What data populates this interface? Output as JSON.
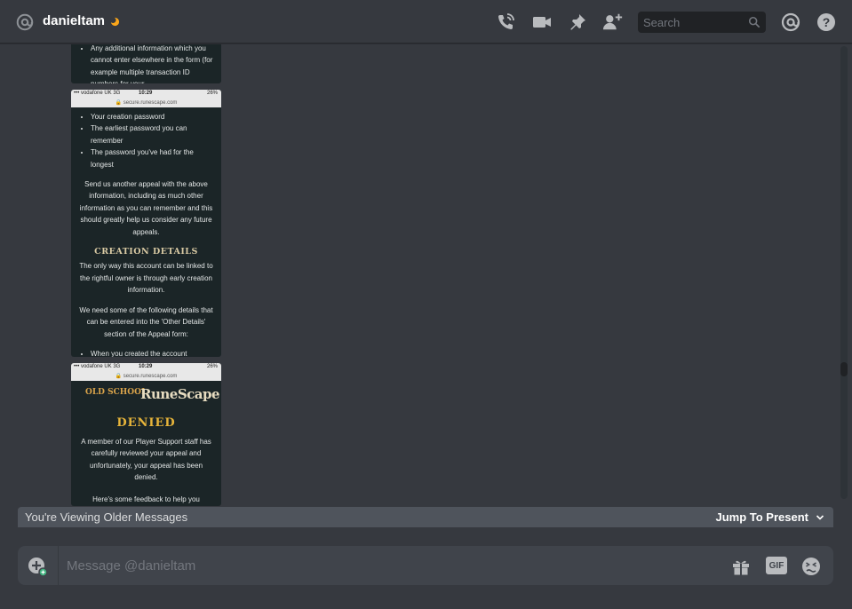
{
  "header": {
    "username": "danieltam",
    "status_icon": "moon-icon",
    "buttons": [
      "start-voice-call-icon",
      "start-video-call-icon",
      "pinned-messages-icon",
      "add-friends-to-dm-icon"
    ],
    "search_placeholder": "Search",
    "mentions_icon": "at-icon",
    "help_icon": "help-icon"
  },
  "attachments": [
    {
      "bullets": [
        "Any additional information which you cannot enter elsewhere in the form (for example multiple transaction ID numbers for your"
      ]
    },
    {
      "status": {
        "carrier": "••• vodafone UK  3G",
        "time": "10:29",
        "battery": "26%",
        "url": "🔒 secure.runescape.com"
      },
      "bullets": [
        "Your creation password",
        "The earliest password you can remember",
        "The password you've had for the longest"
      ],
      "para1": "Send us another appeal with the above information, including as much other information as you can remember and this should greatly help us consider any future appeals.",
      "heading": "CREATION DETAILS",
      "para2": "The only way this account can be linked to the rightful owner is through early creation information.",
      "para3": "We need some of the following details that can be entered into the 'Other Details' section of the Appeal form:",
      "bullet_last": "When you created the account"
    },
    {
      "status": {
        "carrier": "••• vodafone UK  3G",
        "time": "10:29",
        "battery": "26%",
        "url": "🔒 secure.runescape.com"
      },
      "logo_left": "OLD SCHOOL",
      "logo_right": "RuneScape",
      "denied": "DENIED",
      "para1": "A member of our Player Support staff has carefully reviewed your appeal and unfortunately, your appeal has been denied.",
      "para2": "Here's some feedback to help you"
    }
  ],
  "older_bar": {
    "text": "You're Viewing Older Messages",
    "jump_label": "Jump To Present"
  },
  "composer": {
    "placeholder": "Message @danieltam",
    "gif_label": "GIF"
  },
  "colors": {
    "background": "#36393f",
    "composer": "#40444b",
    "older_bar": "#4f545c",
    "denied": "#e6b43a"
  }
}
